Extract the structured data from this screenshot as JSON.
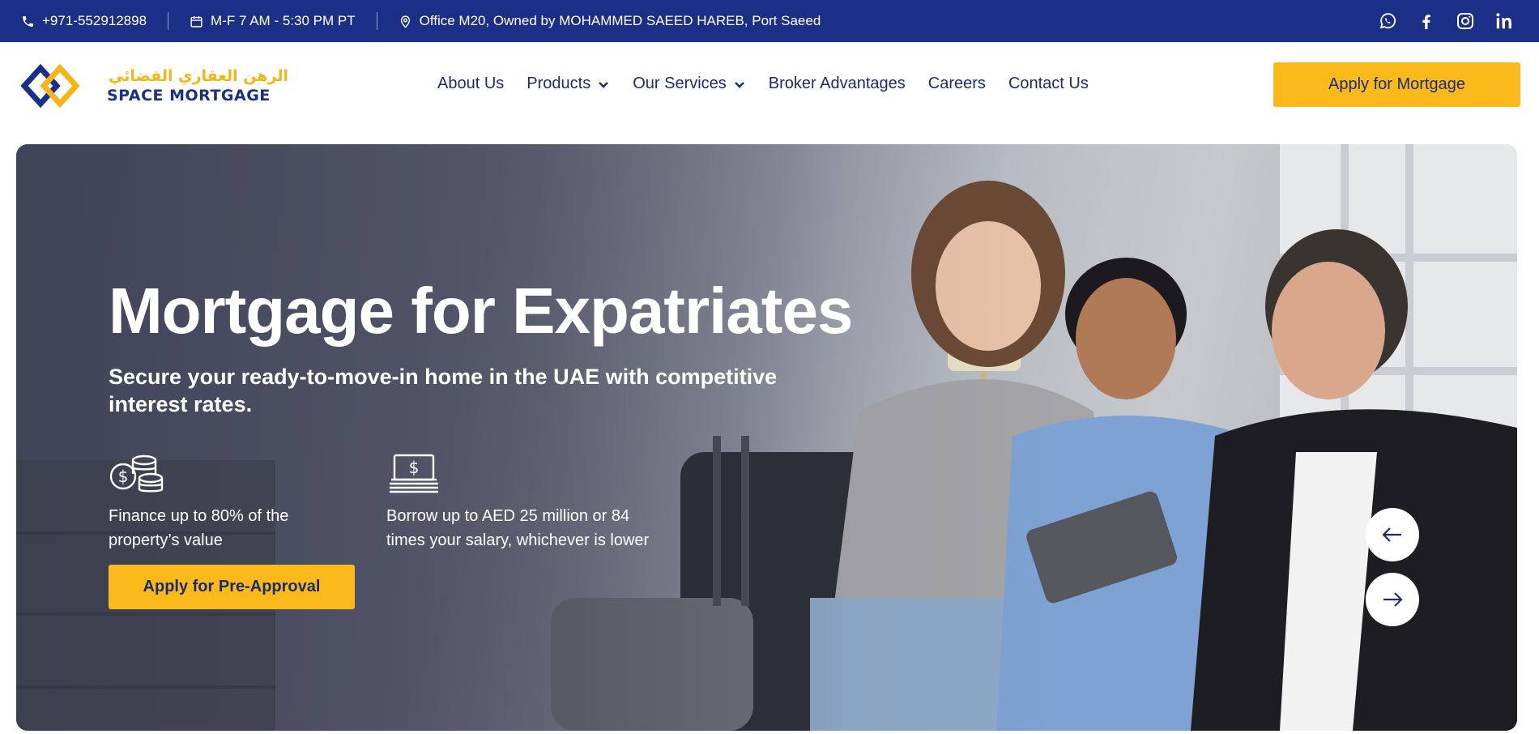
{
  "topbar": {
    "phone": "+971-552912898",
    "hours": "M-F 7 AM - 5:30 PM PT",
    "address": "Office M20, Owned by MOHAMMED SAEED HAREB, Port Saeed",
    "icons": [
      "phone-icon",
      "calendar-icon",
      "location-pin-icon"
    ],
    "social": [
      "whatsapp-icon",
      "facebook-icon",
      "instagram-icon",
      "linkedin-icon"
    ]
  },
  "logo": {
    "arabic": "الرهن العقاري الفضائي",
    "english": "SPACE MORTGAGE"
  },
  "nav": {
    "items": [
      {
        "label": "About Us",
        "dropdown": false
      },
      {
        "label": "Products",
        "dropdown": true
      },
      {
        "label": "Our Services",
        "dropdown": true
      },
      {
        "label": "Broker Advantages",
        "dropdown": false
      },
      {
        "label": "Careers",
        "dropdown": false
      },
      {
        "label": "Contact Us",
        "dropdown": false
      }
    ],
    "cta_label": "Apply for Mortgage"
  },
  "hero": {
    "title": "Mortgage for Expatriates",
    "subtitle": "Secure your ready-to-move-in home in the UAE with competitive interest rates.",
    "features": [
      {
        "icon": "coins-icon",
        "text": "Finance up to 80% of the property’s value"
      },
      {
        "icon": "cash-stack-icon",
        "text": "Borrow up to AED 25 million or 84 times your salary, whichever is lower"
      }
    ],
    "cta_label": "Apply for Pre-Approval",
    "prev_icon": "arrow-left-icon",
    "next_icon": "arrow-right-icon"
  },
  "colors": {
    "topbar_bg": "#1b2f86",
    "accent": "#fbb91c",
    "nav_text": "#1b2c6b"
  }
}
